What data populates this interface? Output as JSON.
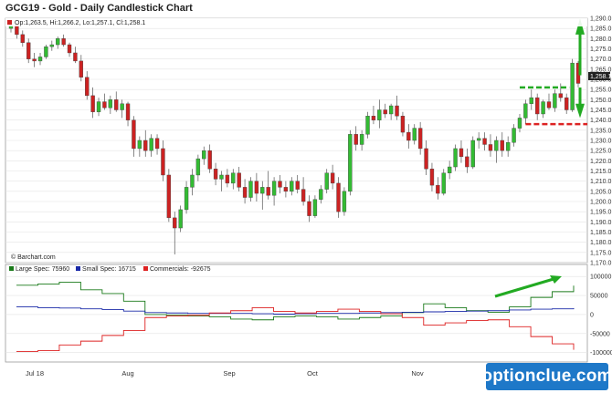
{
  "chart_data": [
    {
      "type": "candlestick",
      "title": "GCG19 - Gold - Daily Candlestick Chart",
      "ohlc_label": "Op:1,263.5, Hi:1,266.2, Lo:1,257.1, Cl:1,258.1",
      "source": "© Barchart.com",
      "last_price_label": "1,258.1",
      "ylim": [
        1170,
        1290
      ],
      "y_ticks": [
        1290,
        1285,
        1280,
        1275,
        1270,
        1265,
        1260,
        1255,
        1250,
        1245,
        1240,
        1235,
        1230,
        1225,
        1220,
        1215,
        1210,
        1205,
        1200,
        1195,
        1190,
        1185,
        1180,
        1175,
        1170
      ],
      "x_labels": [
        "Jul 18",
        "Aug",
        "Sep",
        "Oct",
        "Nov"
      ],
      "colors": {
        "up": "#33bb33",
        "down": "#cc2222",
        "grid": "#dddddd"
      },
      "candles": [
        [
          1285,
          1288,
          1283,
          1287
        ],
        [
          1287,
          1288,
          1280,
          1282
        ],
        [
          1282,
          1284,
          1276,
          1278
        ],
        [
          1278,
          1280,
          1268,
          1270
        ],
        [
          1270,
          1273,
          1266,
          1269
        ],
        [
          1269,
          1273,
          1267,
          1271
        ],
        [
          1271,
          1277,
          1270,
          1276
        ],
        [
          1276,
          1279,
          1274,
          1277
        ],
        [
          1277,
          1281,
          1275,
          1280
        ],
        [
          1280,
          1282,
          1276,
          1277
        ],
        [
          1277,
          1278,
          1271,
          1273
        ],
        [
          1273,
          1276,
          1268,
          1269
        ],
        [
          1269,
          1272,
          1259,
          1261
        ],
        [
          1261,
          1264,
          1250,
          1252
        ],
        [
          1252,
          1256,
          1241,
          1244
        ],
        [
          1244,
          1251,
          1242,
          1249
        ],
        [
          1249,
          1253,
          1245,
          1246
        ],
        [
          1246,
          1252,
          1243,
          1250
        ],
        [
          1250,
          1254,
          1244,
          1245
        ],
        [
          1245,
          1250,
          1241,
          1248
        ],
        [
          1248,
          1249,
          1237,
          1240
        ],
        [
          1240,
          1242,
          1222,
          1226
        ],
        [
          1226,
          1232,
          1222,
          1230
        ],
        [
          1230,
          1235,
          1222,
          1225
        ],
        [
          1225,
          1233,
          1222,
          1231
        ],
        [
          1231,
          1233,
          1223,
          1226
        ],
        [
          1226,
          1230,
          1210,
          1213
        ],
        [
          1213,
          1216,
          1190,
          1192
        ],
        [
          1192,
          1195,
          1174,
          1187
        ],
        [
          1187,
          1198,
          1185,
          1196
        ],
        [
          1196,
          1210,
          1194,
          1207
        ],
        [
          1207,
          1216,
          1203,
          1213
        ],
        [
          1213,
          1223,
          1210,
          1221
        ],
        [
          1221,
          1227,
          1218,
          1225
        ],
        [
          1225,
          1228,
          1214,
          1216
        ],
        [
          1216,
          1219,
          1208,
          1211
        ],
        [
          1211,
          1215,
          1205,
          1213
        ],
        [
          1213,
          1216,
          1207,
          1209
        ],
        [
          1209,
          1216,
          1206,
          1214
        ],
        [
          1214,
          1217,
          1205,
          1207
        ],
        [
          1207,
          1211,
          1199,
          1202
        ],
        [
          1202,
          1212,
          1200,
          1210
        ],
        [
          1210,
          1214,
          1200,
          1204
        ],
        [
          1204,
          1210,
          1196,
          1207
        ],
        [
          1207,
          1215,
          1201,
          1203
        ],
        [
          1203,
          1212,
          1198,
          1210
        ],
        [
          1210,
          1213,
          1204,
          1207
        ],
        [
          1207,
          1210,
          1202,
          1205
        ],
        [
          1205,
          1212,
          1203,
          1210
        ],
        [
          1210,
          1213,
          1204,
          1206
        ],
        [
          1206,
          1212,
          1198,
          1200
        ],
        [
          1200,
          1203,
          1190,
          1193
        ],
        [
          1193,
          1203,
          1192,
          1201
        ],
        [
          1201,
          1208,
          1199,
          1206
        ],
        [
          1206,
          1216,
          1204,
          1214
        ],
        [
          1214,
          1218,
          1206,
          1209
        ],
        [
          1209,
          1212,
          1192,
          1195
        ],
        [
          1195,
          1207,
          1193,
          1205
        ],
        [
          1205,
          1235,
          1203,
          1233
        ],
        [
          1233,
          1237,
          1225,
          1228
        ],
        [
          1228,
          1235,
          1225,
          1233
        ],
        [
          1233,
          1244,
          1231,
          1242
        ],
        [
          1242,
          1247,
          1238,
          1240
        ],
        [
          1240,
          1250,
          1236,
          1245
        ],
        [
          1245,
          1248,
          1241,
          1243
        ],
        [
          1243,
          1248,
          1240,
          1247
        ],
        [
          1247,
          1252,
          1240,
          1242
        ],
        [
          1242,
          1244,
          1232,
          1234
        ],
        [
          1234,
          1238,
          1226,
          1230
        ],
        [
          1230,
          1238,
          1228,
          1236
        ],
        [
          1236,
          1239,
          1223,
          1226
        ],
        [
          1226,
          1230,
          1213,
          1216
        ],
        [
          1216,
          1219,
          1205,
          1208
        ],
        [
          1208,
          1212,
          1201,
          1204
        ],
        [
          1204,
          1216,
          1203,
          1214
        ],
        [
          1214,
          1220,
          1211,
          1217
        ],
        [
          1217,
          1228,
          1215,
          1226
        ],
        [
          1226,
          1230,
          1219,
          1222
        ],
        [
          1222,
          1226,
          1214,
          1217
        ],
        [
          1217,
          1232,
          1216,
          1230
        ],
        [
          1230,
          1234,
          1226,
          1231
        ],
        [
          1231,
          1234,
          1225,
          1228
        ],
        [
          1228,
          1233,
          1222,
          1225
        ],
        [
          1225,
          1232,
          1219,
          1230
        ],
        [
          1230,
          1234,
          1222,
          1225
        ],
        [
          1225,
          1232,
          1222,
          1229
        ],
        [
          1229,
          1238,
          1227,
          1236
        ],
        [
          1236,
          1243,
          1234,
          1241
        ],
        [
          1241,
          1250,
          1238,
          1248
        ],
        [
          1248,
          1255,
          1245,
          1251
        ],
        [
          1251,
          1253,
          1240,
          1243
        ],
        [
          1243,
          1250,
          1241,
          1249
        ],
        [
          1249,
          1253,
          1245,
          1246
        ],
        [
          1246,
          1255,
          1244,
          1253
        ],
        [
          1253,
          1258,
          1249,
          1251
        ],
        [
          1251,
          1253,
          1243,
          1245
        ],
        [
          1245,
          1270,
          1244,
          1268
        ],
        [
          1268,
          1269,
          1256,
          1258
        ]
      ],
      "annotations": {
        "arrow_color": "#22aa22",
        "resistance_color": "#22aa22",
        "support_color": "#dd2222",
        "resistance_level": 1256,
        "support_level": 1238
      }
    },
    {
      "type": "step-line",
      "legend": [
        {
          "label": "Large Spec: 75960",
          "color": "#1a7a1a"
        },
        {
          "label": "Small Spec: 16715",
          "color": "#1a2aa8"
        },
        {
          "label": "Commercials: -92675",
          "color": "#dd2222"
        }
      ],
      "ylim": [
        -120000,
        110000
      ],
      "y_ticks": [
        100000,
        50000,
        0,
        -50000,
        -100000
      ],
      "y_tick_labels": [
        "100000",
        "50000",
        "0",
        "-50000",
        "-100000"
      ],
      "series": [
        {
          "name": "Large Spec",
          "color": "#1a7a1a",
          "values": [
            77000,
            80000,
            85000,
            65000,
            55000,
            35000,
            0,
            -2000,
            -4000,
            -6000,
            -12000,
            -14000,
            -6000,
            -4000,
            -6000,
            -12000,
            -8000,
            -4000,
            5000,
            28000,
            18000,
            10000,
            6000,
            20000,
            45000,
            60000,
            76000
          ]
        },
        {
          "name": "Small Spec",
          "color": "#1a2aa8",
          "values": [
            20000,
            18000,
            17000,
            15000,
            13000,
            9000,
            5000,
            4000,
            3000,
            3000,
            3000,
            2000,
            1000,
            2000,
            3000,
            3000,
            4000,
            5000,
            6000,
            7000,
            8000,
            9000,
            10000,
            12000,
            14000,
            15000,
            16715
          ]
        },
        {
          "name": "Commercials",
          "color": "#dd2222",
          "values": [
            -97000,
            -95000,
            -80000,
            -70000,
            -55000,
            -42000,
            -8000,
            -4000,
            -2000,
            4000,
            10000,
            18000,
            8000,
            4000,
            8000,
            14000,
            8000,
            2000,
            -8000,
            -28000,
            -22000,
            -16000,
            -14000,
            -32000,
            -58000,
            -77000,
            -92675
          ]
        }
      ]
    }
  ],
  "x_labels_bottom": [
    "Jul 18",
    "Aug",
    "Sep",
    "Oct",
    "Nov"
  ],
  "branding": {
    "watermark": "optionclue.com"
  }
}
